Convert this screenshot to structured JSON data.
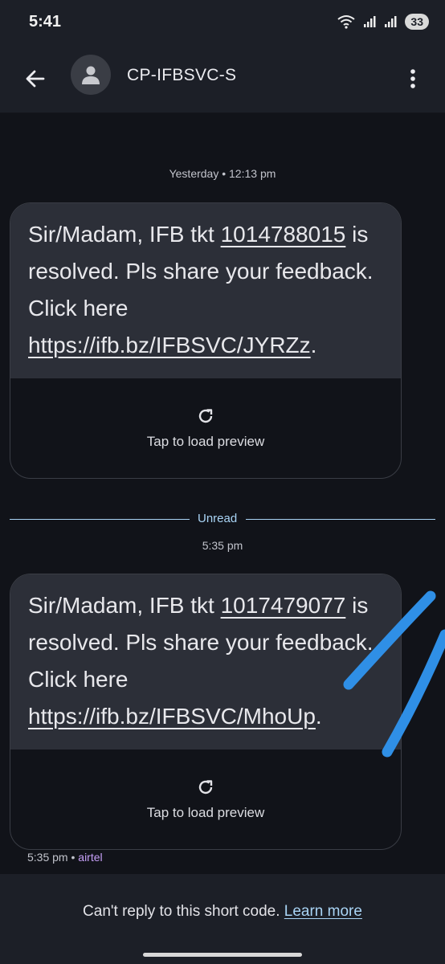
{
  "status": {
    "time": "5:41",
    "battery": "33"
  },
  "header": {
    "contact": "CP-IFBSVC-S"
  },
  "messages": [
    {
      "timestamp": "Yesterday • 12:13 pm",
      "text_a": "Sir/Madam, IFB tkt ",
      "ticket": "1014788015",
      "text_b": " is resolved. Pls share your feedback. Click here ",
      "link": "https://ifb.bz/IFBSVC/JYRZz",
      "text_c": ".",
      "preview": "Tap to load preview"
    },
    {
      "timestamp": "5:35 pm",
      "text_a": "Sir/Madam, IFB tkt ",
      "ticket": "1017479077",
      "text_b": " is resolved. Pls share your feedback. Click here ",
      "link": "https://ifb.bz/IFBSVC/MhoUp",
      "text_c": ".",
      "preview": "Tap to load preview"
    }
  ],
  "unread": "Unread",
  "meta": {
    "time": "5:35 pm",
    "sep": " • ",
    "carrier": "airtel"
  },
  "footer": {
    "text": "Can't reply to this short code. ",
    "link": "Learn more"
  },
  "colors": {
    "accent": "#a9d4f5",
    "carrier": "#c6a0f8",
    "scribble": "#2f8fe6"
  }
}
